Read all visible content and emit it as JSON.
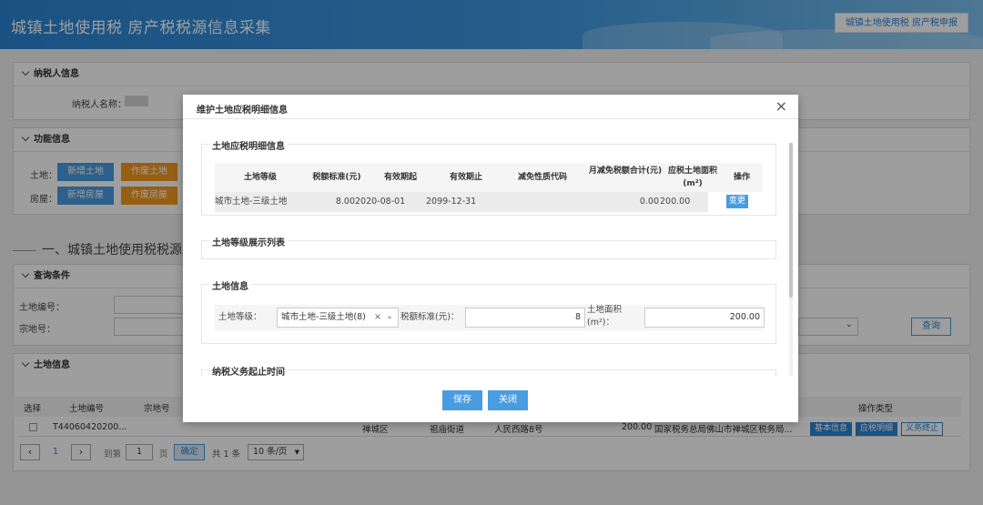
{
  "header": {
    "title": "城镇土地使用税 房产税税源信息采集",
    "tab_button": "城镇土地使用税 房产税申报"
  },
  "taxpayer": {
    "section": "纳税人信息",
    "name_label": "纳税人名称："
  },
  "function": {
    "section": "功能信息",
    "land_label": "土地：",
    "add_land": "新增土地",
    "void_land": "作废土地",
    "house_label": "房屋：",
    "add_house": "新增房屋",
    "void_house": "作废房屋"
  },
  "section_title": "一、城镇土地使用税税源明细",
  "query": {
    "section": "查询条件",
    "land_no_label": "土地编号：",
    "parcel_no_label": "宗地号：",
    "search_button": "查询"
  },
  "land_info": {
    "section": "土地信息",
    "col_select": "选择",
    "col_land_no": "土地编号",
    "col_parcel_no": "宗地号",
    "col_op_type": "操作类型",
    "row": {
      "land_no": "T44060420200...",
      "district": "禅城区",
      "street": "祖庙街道",
      "address": "人民西路8号",
      "area": "200.00",
      "authority": "国家税务总局佛山市禅城区税务局...",
      "btn_basic": "基本信息",
      "btn_detail": "应税明细",
      "btn_end": "义务终止"
    }
  },
  "pager": {
    "current": "1",
    "goto_label": "到第",
    "page_input": "1",
    "page_unit": "页",
    "confirm": "确定",
    "total": "共 1 条",
    "per_page": "10 条/页"
  },
  "modal": {
    "title": "维护土地应税明细信息",
    "close": "×",
    "detail_section": "土地应税明细信息",
    "columns": [
      "土地等级",
      "税额标准(元)",
      "有效期起",
      "有效期止",
      "减免性质代码",
      "月减免税额合计(元)",
      "应税土地面积(m²)",
      "操作"
    ],
    "row": {
      "grade": "城市土地-三级土地",
      "rate": "8.00",
      "start": "2020-08-01",
      "end": "2099-12-31",
      "code": "",
      "reduction": "0.00",
      "area": "200.00",
      "action": "变更"
    },
    "grade_list_section": "土地等级展示列表",
    "land_section": "土地信息",
    "grade_label": "土地等级：",
    "grade_value": "城市土地-三级土地(8)",
    "rate_label": "税额标准(元)：",
    "rate_value": "8",
    "area_label": "土地面积(m²)：",
    "area_value": "200.00",
    "period_section": "纳税义务起止时间",
    "save": "保存",
    "close_btn": "关闭"
  }
}
